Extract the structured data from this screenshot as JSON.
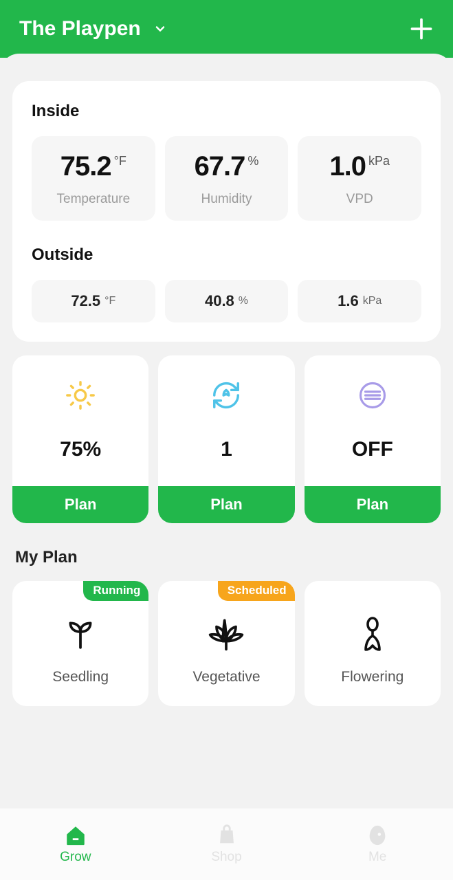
{
  "header": {
    "title": "The Playpen"
  },
  "inside": {
    "label": "Inside",
    "metrics": [
      {
        "value": "75.2",
        "unit": "°F",
        "name": "Temperature"
      },
      {
        "value": "67.7",
        "unit": "%",
        "name": "Humidity"
      },
      {
        "value": "1.0",
        "unit": "kPa",
        "name": "VPD"
      }
    ]
  },
  "outside": {
    "label": "Outside",
    "metrics": [
      {
        "value": "72.5",
        "unit": "°F"
      },
      {
        "value": "40.8",
        "unit": "%"
      },
      {
        "value": "1.6",
        "unit": "kPa"
      }
    ]
  },
  "devices": [
    {
      "icon": "sun",
      "value": "75%",
      "plan_label": "Plan"
    },
    {
      "icon": "circulate",
      "value": "1",
      "plan_label": "Plan"
    },
    {
      "icon": "filter",
      "value": "OFF",
      "plan_label": "Plan"
    }
  ],
  "my_plan": {
    "label": "My Plan",
    "stages": [
      {
        "badge": "Running",
        "badge_kind": "running",
        "icon": "seedling",
        "name": "Seedling"
      },
      {
        "badge": "Scheduled",
        "badge_kind": "scheduled",
        "icon": "leaf",
        "name": "Vegetative"
      },
      {
        "badge": null,
        "badge_kind": null,
        "icon": "flowering",
        "name": "Flowering"
      }
    ]
  },
  "tabs": [
    {
      "name": "Grow",
      "active": true
    },
    {
      "name": "Shop",
      "active": false
    },
    {
      "name": "Me",
      "active": false
    }
  ]
}
